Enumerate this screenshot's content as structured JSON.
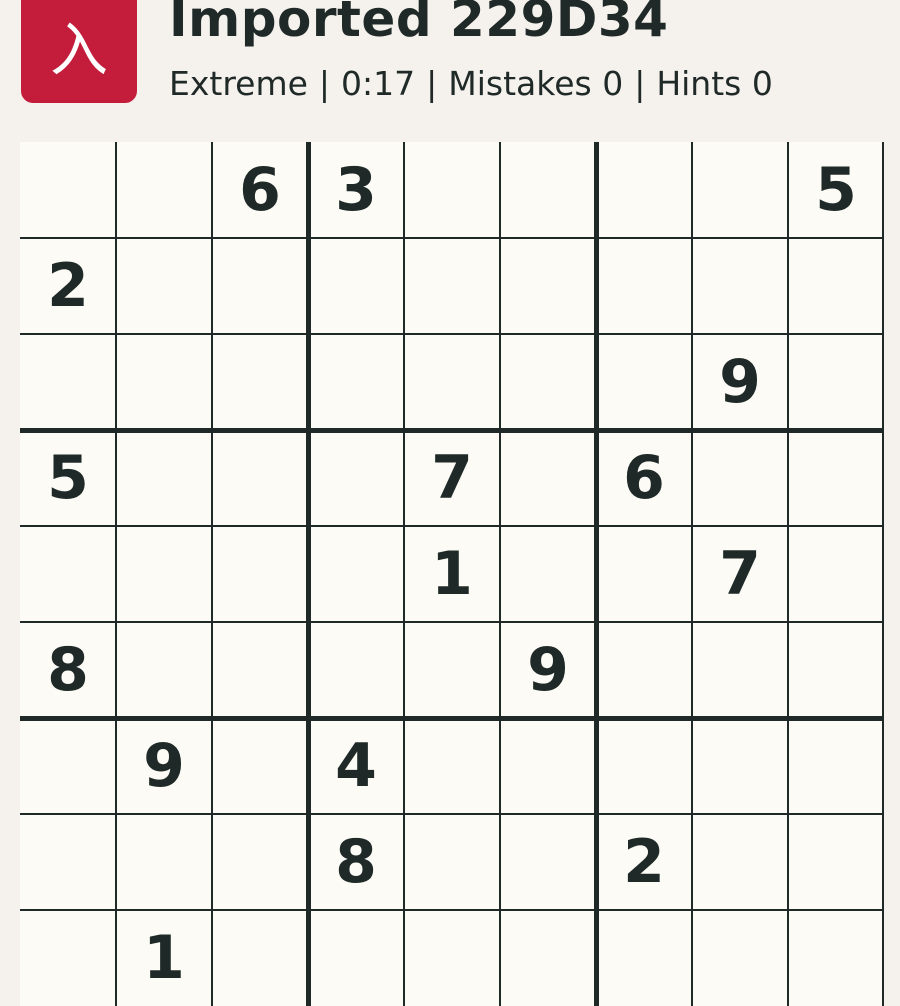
{
  "header": {
    "logo_glyph": "入",
    "title": "Imported 229D34",
    "difficulty": "Extreme",
    "timer": "0:17",
    "mistakes": "Mistakes 0",
    "hints": "Hints 0",
    "separator": "|"
  },
  "colors": {
    "accent": "#c41d3b",
    "background": "#f5f1ec",
    "board": "#fdfbf6",
    "ink": "#1f2a28"
  },
  "board": {
    "rows": [
      [
        "",
        "",
        "6",
        "3",
        "",
        "",
        "",
        "",
        "5"
      ],
      [
        "2",
        "",
        "",
        "",
        "",
        "",
        "",
        "",
        ""
      ],
      [
        "",
        "",
        "",
        "",
        "",
        "",
        "",
        "9",
        ""
      ],
      [
        "5",
        "",
        "",
        "",
        "7",
        "",
        "6",
        "",
        ""
      ],
      [
        "",
        "",
        "",
        "",
        "1",
        "",
        "",
        "7",
        ""
      ],
      [
        "8",
        "",
        "",
        "",
        "",
        "9",
        "",
        "",
        ""
      ],
      [
        "",
        "9",
        "",
        "4",
        "",
        "",
        "",
        "",
        ""
      ],
      [
        "",
        "",
        "",
        "8",
        "",
        "",
        "2",
        "",
        ""
      ],
      [
        "",
        "1",
        "",
        "",
        "",
        "",
        "",
        "",
        ""
      ]
    ]
  }
}
